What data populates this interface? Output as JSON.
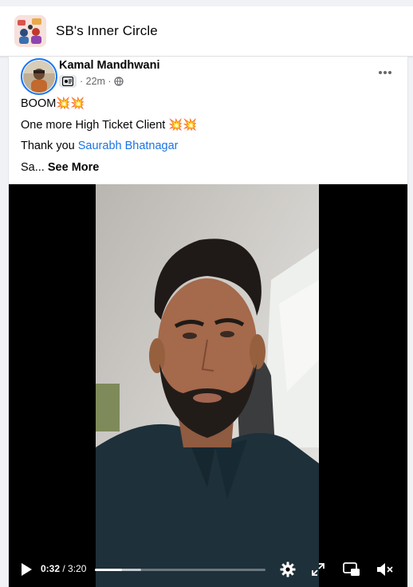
{
  "group": {
    "name": "SB's Inner Circle",
    "avatar_icon": "group-photo-thumbnail"
  },
  "post": {
    "author": "Kamal Mandhwani",
    "badge_icon": "member-badge-icon",
    "time": "· 22m ·",
    "privacy_icon": "globe-icon",
    "more_icon": "ellipsis-icon",
    "lines": {
      "line1": "BOOM💥💥",
      "line2": "One more High Ticket Client 💥💥",
      "line3_prefix": "Thank you ",
      "line3_mention": "Saurabh Bhatnagar",
      "line4_prefix": "Sa... ",
      "see_more": "See More"
    }
  },
  "video": {
    "play_icon": "play-icon",
    "current_time": "0:32",
    "duration": " / 3:20",
    "played_fraction": 0.16,
    "buffered_fraction": 0.27,
    "settings_icon": "gear-icon",
    "fullscreen_icon": "expand-icon",
    "pip_icon": "picture-in-picture-icon",
    "volume_icon": "muted-speaker-icon"
  },
  "colors": {
    "accent": "#1877f2",
    "link": "#1b74e4",
    "page_bg": "#f0f2f5"
  }
}
